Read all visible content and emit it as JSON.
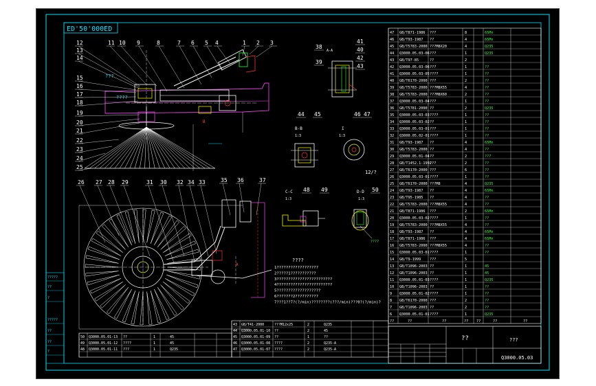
{
  "drawing": {
    "title_code": "ED'50'000ED",
    "drawing_number": "Q3000.05.03",
    "title_block_name": "??",
    "title_block_sub": "???",
    "balloons_top": [
      "12",
      "13",
      "14",
      "11",
      "10",
      "9",
      "8",
      "7",
      "6",
      "5",
      "4",
      "1",
      "2",
      "3"
    ],
    "balloons_left": [
      "15",
      "16",
      "17",
      "18",
      "19",
      "20",
      "21",
      "22",
      "23",
      "24",
      "25"
    ],
    "balloons_mid": [
      "26",
      "27",
      "28",
      "29",
      "31",
      "30",
      "32",
      "34",
      "33",
      "35",
      "36",
      "37"
    ],
    "balloons_detail": [
      "38",
      "41",
      "40",
      "39",
      "42",
      "43",
      "44",
      "45",
      "46",
      "47",
      "48",
      "49",
      "50"
    ],
    "section_labels": {
      "aa": "A-A",
      "bb": "B-B",
      "i": "I",
      "cc": "C-C",
      "dd": "D-D",
      "scale_a": "1:3",
      "scale_b": "1:3",
      "scale_c": "1:3",
      "scale_d": "1:3",
      "scale_e": "1:3",
      "note_num": "12/?"
    },
    "notes": [
      "1??????????????????",
      "2?????1???????????",
      "3????????????????????????",
      "4????????????????????????",
      "5???????????????????",
      "6???????2??????????",
      "7???1??7?(?/min)????????(???/min)???0?(?/min)?"
    ],
    "notes_title": "????",
    "parts_list": [
      [
        "47",
        "GB/T871-1986",
        "???",
        "8",
        "",
        "65Mn",
        ""
      ],
      [
        "46",
        "GB/T93-1987",
        "??",
        "4",
        "",
        "65Mn",
        ""
      ],
      [
        "45",
        "GB/T5783-2000",
        "???M8X20",
        "4",
        "",
        "Q235",
        ""
      ],
      [
        "44",
        "Q3000.05.03-06",
        "???",
        "1",
        "",
        "Q235",
        ""
      ],
      [
        "43",
        "GB/T97-85",
        "??",
        "2",
        "",
        "",
        ""
      ],
      [
        "42",
        "Q3000.05.03-06",
        "???",
        "1",
        "",
        "??",
        ""
      ],
      [
        "41",
        "Q3000.05.03-05",
        "????",
        "1",
        "",
        "??",
        ""
      ],
      [
        "40",
        "GB/T6170-2000",
        "???",
        "2",
        "",
        "??",
        ""
      ],
      [
        "39",
        "GB/T5783-2000",
        "???M8X55",
        "4",
        "",
        "??",
        ""
      ],
      [
        "38",
        "GB/T5783-2000",
        "???M8X60",
        "2",
        "",
        "??",
        ""
      ],
      [
        "37",
        "Q3000.05.03-04",
        "???",
        "1",
        "",
        "??",
        ""
      ],
      [
        "36",
        "GB/T5781-2000",
        "??",
        "2",
        "",
        "Q235",
        ""
      ],
      [
        "35",
        "Q3000.05.03-03",
        "????",
        "1",
        "",
        "??",
        ""
      ],
      [
        "34",
        "Q3000.05.03-02",
        "??",
        "1",
        "",
        "??",
        ""
      ],
      [
        "33",
        "Q3000.05.03-01",
        "???",
        "1",
        "",
        "??",
        ""
      ],
      [
        "32",
        "Q3000.05.02-01",
        "????",
        "1",
        "",
        "??",
        ""
      ],
      [
        "31",
        "GB/T93-1987",
        "??",
        "4",
        "",
        "65Mn",
        ""
      ],
      [
        "30",
        "GB/T5783-2000",
        "??",
        "4",
        "",
        "??",
        ""
      ],
      [
        "29",
        "Q3000.05.01-04",
        "??",
        "2",
        "",
        "???",
        ""
      ],
      [
        "28",
        "GB/T1452.1-1992",
        "???",
        "2",
        "",
        "??",
        ""
      ],
      [
        "27",
        "GB/T6170-2000",
        "???",
        "6",
        "",
        "??",
        ""
      ],
      [
        "26",
        "Q3000.05.03-01",
        "????",
        "1",
        "",
        "??",
        ""
      ],
      [
        "25",
        "GB/T6170-2000",
        "???M8",
        "4",
        "",
        "Q235",
        ""
      ],
      [
        "24",
        "GB/T93-1987",
        "??",
        "4",
        "",
        "65Mn",
        ""
      ],
      [
        "23",
        "GB/T95-1985",
        "??",
        "4",
        "",
        "??",
        ""
      ],
      [
        "22",
        "GB/T5783-2000",
        "???M8X55",
        "4",
        "",
        "??",
        ""
      ],
      [
        "21",
        "GB/T871-1986",
        "???",
        "2",
        "",
        "65Mn",
        ""
      ],
      [
        "20",
        "Q3000.05.03-02",
        "????",
        "1",
        "",
        "??",
        ""
      ],
      [
        "19",
        "GB/T5783-2000",
        "???M8X55",
        "4",
        "",
        "??",
        ""
      ],
      [
        "18",
        "GB/T93-1987",
        "??",
        "4",
        "",
        "65Mn",
        ""
      ],
      [
        "17",
        "GB/T871-1986",
        "???",
        "4",
        "",
        "65Mn",
        ""
      ],
      [
        "16",
        "GB/T5783-2000",
        "???M8X55",
        "4",
        "",
        "??",
        ""
      ],
      [
        "15",
        "Q3000.05.03-01",
        "????",
        "1",
        "",
        "??",
        ""
      ],
      [
        "14",
        "GB/T9-1999",
        "???",
        "5",
        "",
        "",
        ""
      ],
      [
        "13",
        "GB/T1096-2003",
        "??",
        "1",
        "",
        "45",
        ""
      ],
      [
        "12",
        "GB/T1096-2003",
        "??",
        "1",
        "",
        "45",
        ""
      ],
      [
        "11",
        "Q3000.05.01-03",
        "????",
        "1",
        "",
        "Q235",
        ""
      ],
      [
        "10",
        "GB/T1096-2003",
        "??",
        "1",
        "",
        "??",
        ""
      ],
      [
        "9",
        "Q3000.05.01-02",
        "????",
        "1",
        "",
        "??",
        ""
      ],
      [
        "8",
        "GB/T6170-2000",
        "???",
        "2",
        "",
        "??",
        ""
      ],
      [
        "7",
        "GB/T1096-2003",
        "??",
        "2",
        "",
        "??",
        ""
      ],
      [
        "6",
        "Q3000.05.01-01",
        "????",
        "1",
        "",
        "Q235",
        ""
      ]
    ],
    "parts_header": [
      "??",
      "??",
      "??",
      "??",
      "??",
      "??",
      "??"
    ],
    "bottom_list_right": [
      [
        "43",
        "GB/T41-2000",
        "???M12x25",
        "2",
        "Q235",
        ""
      ],
      [
        "44",
        "Q3000.05.01-10",
        "??",
        "2",
        "45",
        ""
      ],
      [
        "45",
        "Q3000.05.01-09",
        "??",
        "1",
        "??",
        ""
      ],
      [
        "46",
        "Q3000.05.01-08",
        "????",
        "2",
        "Q235-A",
        ""
      ],
      [
        "47",
        "Q3000.05.01-07",
        "????",
        "2",
        "Q235-A",
        ""
      ]
    ],
    "bottom_list_left": [
      [
        "50",
        "Q3000.05.01-13",
        "??",
        "1",
        "45",
        ""
      ],
      [
        "49",
        "Q3000.05.01-12",
        "????",
        "1",
        "45",
        ""
      ],
      [
        "48",
        "Q3000.05.01-11",
        "???",
        "1",
        "Q235",
        ""
      ]
    ],
    "left_margin_labels": [
      "?????",
      "??",
      "?",
      "?????",
      "??",
      "??",
      "?"
    ]
  }
}
